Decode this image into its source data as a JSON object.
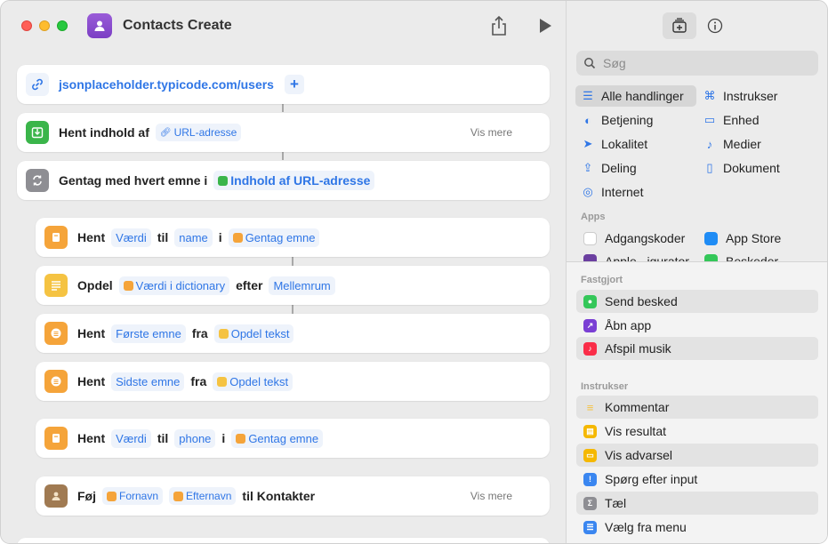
{
  "window": {
    "title": "Contacts Create"
  },
  "workflow": {
    "url_card": {
      "url": "jsonplaceholder.typicode.com/users",
      "plus": "+"
    },
    "fetch_card": {
      "verb": "Hent indhold af",
      "token": "URL-adresse",
      "more": "Vis mere"
    },
    "repeat_card": {
      "verb": "Gentag med hvert emne i",
      "token": "Indhold af URL-adresse"
    },
    "get_name": {
      "verb": "Hent",
      "key_label": "Værdi",
      "til": "til",
      "key": "name",
      "i": "i",
      "source": "Gentag emne"
    },
    "split": {
      "verb": "Opdel",
      "token": "Værdi i dictionary",
      "efter": "efter",
      "sep": "Mellemrum"
    },
    "first": {
      "verb": "Hent",
      "token": "Første emne",
      "fra": "fra",
      "source": "Opdel tekst"
    },
    "last": {
      "verb": "Hent",
      "token": "Sidste emne",
      "fra": "fra",
      "source": "Opdel tekst"
    },
    "get_phone": {
      "verb": "Hent",
      "key_label": "Værdi",
      "til": "til",
      "key": "phone",
      "i": "i",
      "source": "Gentag emne"
    },
    "add_contact": {
      "verb": "Føj",
      "first": "Fornavn",
      "last": "Efternavn",
      "to": "til Kontakter",
      "more": "Vis mere"
    }
  },
  "sidebar": {
    "search_placeholder": "Søg",
    "categories": [
      {
        "label": "Alle handlinger",
        "icon": "list-icon"
      },
      {
        "label": "Instrukser",
        "icon": "scripting-icon"
      },
      {
        "label": "Betjening",
        "icon": "toggles-icon"
      },
      {
        "label": "Enhed",
        "icon": "display-icon"
      },
      {
        "label": "Lokalitet",
        "icon": "location-arrow-icon"
      },
      {
        "label": "Medier",
        "icon": "music-note-icon"
      },
      {
        "label": "Deling",
        "icon": "share-icon"
      },
      {
        "label": "Dokument",
        "icon": "document-icon"
      },
      {
        "label": "Internet",
        "icon": "compass-icon"
      }
    ],
    "apps_label": "Apps",
    "apps": [
      {
        "label": "Adgangskoder",
        "color": "#ffffff"
      },
      {
        "label": "App Store",
        "color": "#1f8cf5"
      },
      {
        "label": "Apple...igurator",
        "color": "#6b3fa0"
      },
      {
        "label": "Beskeder",
        "color": "#34c759"
      }
    ],
    "pinned_label": "Fastgjort",
    "pinned": [
      {
        "label": "Send besked",
        "color": "#34c759"
      },
      {
        "label": "Åbn app",
        "color": "#7a3fd4"
      },
      {
        "label": "Afspil musik",
        "color": "#fa2d48"
      }
    ],
    "scripting_label": "Instrukser",
    "scripting": [
      {
        "label": "Kommentar",
        "color": "#f5c342"
      },
      {
        "label": "Vis resultat",
        "color": "#f5b800"
      },
      {
        "label": "Vis advarsel",
        "color": "#f5b800"
      },
      {
        "label": "Spørg efter input",
        "color": "#3a86f0"
      },
      {
        "label": "Tæl",
        "color": "#8e8e93"
      },
      {
        "label": "Vælg fra menu",
        "color": "#3a86f0"
      }
    ]
  }
}
